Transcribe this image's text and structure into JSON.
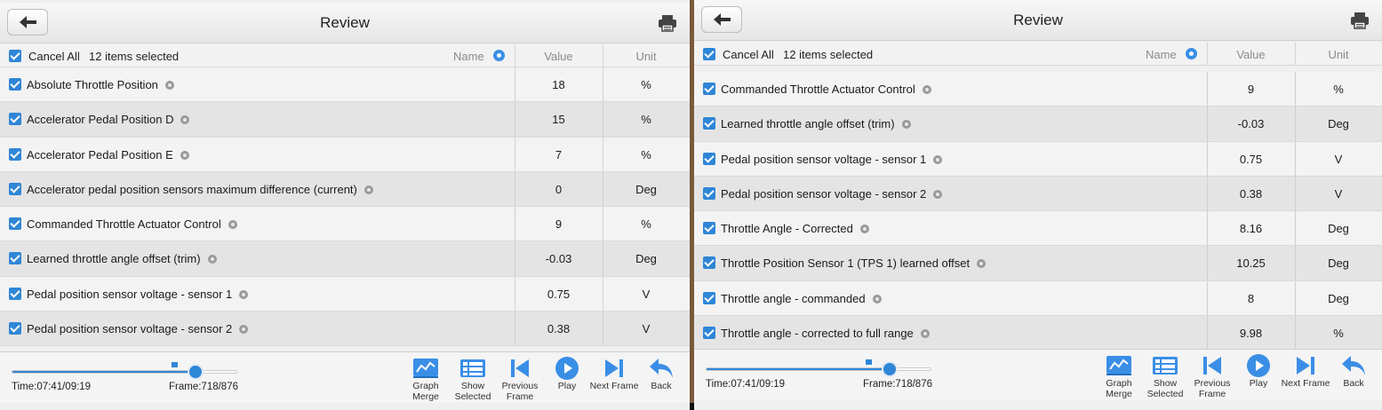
{
  "panels": [
    {
      "title": "Review",
      "header": {
        "cancel_all": "Cancel All",
        "selected_count": "12 items selected",
        "col_name": "Name",
        "col_value": "Value",
        "col_unit": "Unit"
      },
      "rows": [
        {
          "name": "Absolute Throttle Position",
          "value": "18",
          "unit": "%"
        },
        {
          "name": "Accelerator Pedal Position D",
          "value": "15",
          "unit": "%"
        },
        {
          "name": "Accelerator Pedal Position E",
          "value": "7",
          "unit": "%"
        },
        {
          "name": "Accelerator pedal position sensors maximum difference (current)",
          "value": "0",
          "unit": "Deg"
        },
        {
          "name": "Commanded Throttle Actuator Control",
          "value": "9",
          "unit": "%"
        },
        {
          "name": "Learned throttle angle offset (trim)",
          "value": "-0.03",
          "unit": "Deg"
        },
        {
          "name": "Pedal position sensor voltage - sensor 1",
          "value": "0.75",
          "unit": "V"
        },
        {
          "name": "Pedal position sensor voltage - sensor 2",
          "value": "0.38",
          "unit": "V"
        }
      ],
      "playback": {
        "time": "Time:07:41/09:19",
        "frame": "Frame:718/876",
        "progress": 0.82
      },
      "toolbar": [
        {
          "label_1": "Graph",
          "label_2": "Merge",
          "icon": "graph-merge-icon"
        },
        {
          "label_1": "Show",
          "label_2": "Selected",
          "icon": "show-selected-icon"
        },
        {
          "label_1": "Previous",
          "label_2": "Frame",
          "icon": "previous-frame-icon"
        },
        {
          "label_1": "Play",
          "label_2": "",
          "icon": "play-icon"
        },
        {
          "label_1": "Next Frame",
          "label_2": "",
          "icon": "next-frame-icon"
        },
        {
          "label_1": "Back",
          "label_2": "",
          "icon": "back-icon"
        }
      ]
    },
    {
      "title": "Review",
      "header": {
        "cancel_all": "Cancel All",
        "selected_count": "12 items selected",
        "col_name": "Name",
        "col_value": "Value",
        "col_unit": "Unit"
      },
      "rows": [
        {
          "name": "Commanded Throttle Actuator Control",
          "value": "9",
          "unit": "%"
        },
        {
          "name": "Learned throttle angle offset (trim)",
          "value": "-0.03",
          "unit": "Deg"
        },
        {
          "name": "Pedal position sensor voltage - sensor 1",
          "value": "0.75",
          "unit": "V"
        },
        {
          "name": "Pedal position sensor voltage - sensor 2",
          "value": "0.38",
          "unit": "V"
        },
        {
          "name": "Throttle Angle - Corrected",
          "value": "8.16",
          "unit": "Deg"
        },
        {
          "name": "Throttle Position Sensor 1 (TPS 1) learned offset",
          "value": "10.25",
          "unit": "Deg"
        },
        {
          "name": "Throttle angle - commanded",
          "value": "8",
          "unit": "Deg"
        },
        {
          "name": "Throttle angle - corrected to full range",
          "value": "9.98",
          "unit": "%"
        }
      ],
      "playback": {
        "time": "Time:07:41/09:19",
        "frame": "Frame:718/876",
        "progress": 0.82
      },
      "toolbar": [
        {
          "label_1": "Graph",
          "label_2": "Merge",
          "icon": "graph-merge-icon"
        },
        {
          "label_1": "Show",
          "label_2": "Selected",
          "icon": "show-selected-icon"
        },
        {
          "label_1": "Previous",
          "label_2": "Frame",
          "icon": "previous-frame-icon"
        },
        {
          "label_1": "Play",
          "label_2": "",
          "icon": "play-icon"
        },
        {
          "label_1": "Next Frame",
          "label_2": "",
          "icon": "next-frame-icon"
        },
        {
          "label_1": "Back",
          "label_2": "",
          "icon": "back-icon"
        }
      ]
    }
  ],
  "colors": {
    "accent": "#2f86d6",
    "background": "#efefef",
    "row_alt": "#e4e4e4"
  }
}
